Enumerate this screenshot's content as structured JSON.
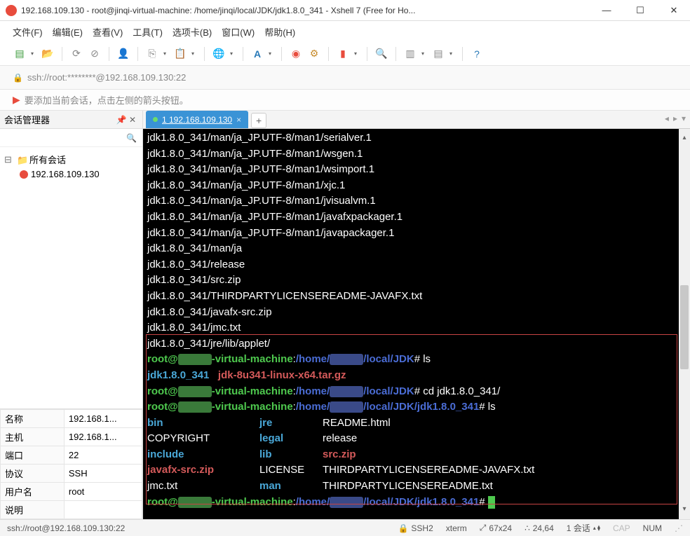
{
  "title": "192.168.109.130 - root@jinqi-virtual-machine: /home/jinqi/local/JDK/jdk1.8.0_341 - Xshell 7 (Free for Ho...",
  "menu": {
    "file": "文件(F)",
    "edit": "编辑(E)",
    "view": "查看(V)",
    "tools": "工具(T)",
    "tabs": "选项卡(B)",
    "window": "窗口(W)",
    "help": "帮助(H)"
  },
  "address": "ssh://root:********@192.168.109.130:22",
  "hint": "要添加当前会话，点击左侧的箭头按钮。",
  "sidebar": {
    "title": "会话管理器",
    "root": "所有会话",
    "session": "192.168.109.130"
  },
  "props": {
    "name_lbl": "名称",
    "name_val": "192.168.1...",
    "host_lbl": "主机",
    "host_val": "192.168.1...",
    "port_lbl": "端口",
    "port_val": "22",
    "proto_lbl": "协议",
    "proto_val": "SSH",
    "user_lbl": "用户名",
    "user_val": "root",
    "desc_lbl": "说明",
    "desc_val": ""
  },
  "tab": {
    "label": "1 192.168.109.130"
  },
  "term": {
    "lines": [
      "jdk1.8.0_341/man/ja_JP.UTF-8/man1/serialver.1",
      "jdk1.8.0_341/man/ja_JP.UTF-8/man1/wsgen.1",
      "jdk1.8.0_341/man/ja_JP.UTF-8/man1/wsimport.1",
      "jdk1.8.0_341/man/ja_JP.UTF-8/man1/xjc.1",
      "jdk1.8.0_341/man/ja_JP.UTF-8/man1/jvisualvm.1",
      "jdk1.8.0_341/man/ja_JP.UTF-8/man1/javafxpackager.1",
      "jdk1.8.0_341/man/ja_JP.UTF-8/man1/javapackager.1",
      "jdk1.8.0_341/man/ja",
      "jdk1.8.0_341/release",
      "jdk1.8.0_341/src.zip",
      "jdk1.8.0_341/THIRDPARTYLICENSEREADME-JAVAFX.txt",
      "jdk1.8.0_341/javafx-src.zip",
      "jdk1.8.0_341/jmc.txt",
      "jdk1.8.0_341/jre/lib/applet/"
    ],
    "p1a": "root@",
    "p1b": "-virtual-machine",
    "p1c": "/home/",
    "p1d": "/local/JDK",
    "cmd1": "# ls",
    "ls1a": "jdk1.8.0_341",
    "ls1b": "jdk-8u341-linux-x64.tar.gz",
    "cmd2": "# cd jdk1.8.0_341/",
    "p3d": "/local/JDK/jdk1.8.0_341",
    "cmd3": "# ls",
    "row1_a": "bin",
    "row1_b": "jre",
    "row1_c": "README.html",
    "row2_a": "COPYRIGHT",
    "row2_b": "legal",
    "row2_c": "release",
    "row3_a": "include",
    "row3_b": "lib",
    "row3_c": "src.zip",
    "row4_a": "javafx-src.zip",
    "row4_b": "LICENSE",
    "row4_c": "THIRDPARTYLICENSEREADME-JAVAFX.txt",
    "row5_a": "jmc.txt",
    "row5_b": "man",
    "row5_c": "THIRDPARTYLICENSEREADME.txt",
    "p4d": "/local/JDK/jdk1.8.0_341",
    "p4e": "# "
  },
  "status": {
    "conn": "ssh://root@192.168.109.130:22",
    "ssh": "SSH2",
    "term": "xterm",
    "size": "67x24",
    "pos": "24,64",
    "sess": "1 会话",
    "cap": "CAP",
    "num": "NUM"
  }
}
